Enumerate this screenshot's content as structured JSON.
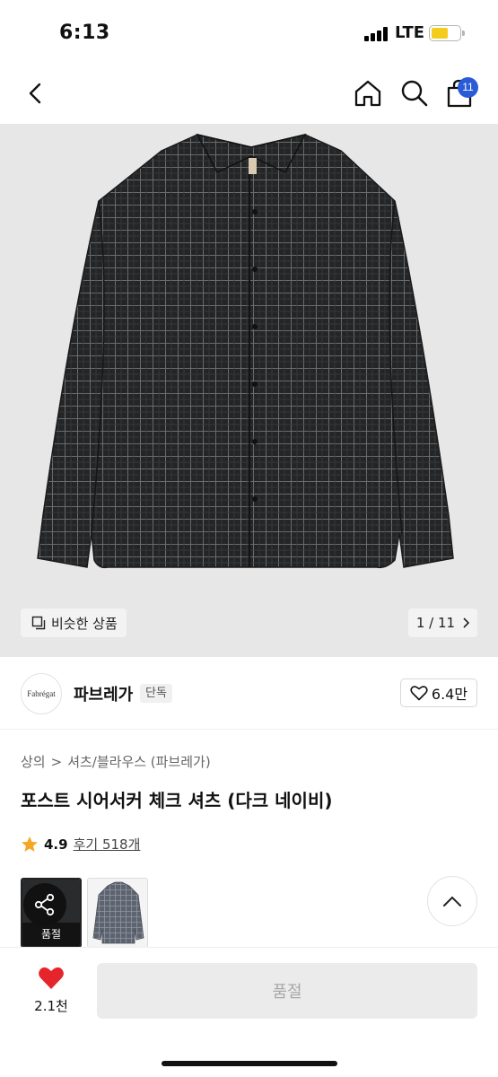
{
  "status_bar": {
    "time": "6:13",
    "network": "LTE"
  },
  "nav": {
    "cart_count": "11"
  },
  "gallery": {
    "similar_label": "비슷한 상품",
    "counter": "1 / 11"
  },
  "brand": {
    "logo_text": "Fabrégat",
    "name": "파브레가",
    "badge": "단독",
    "likes": "6.4만"
  },
  "product": {
    "breadcrumb": [
      "상의",
      "셔츠/블라우스 (파브레가)"
    ],
    "title": "포스트 시어서커 체크 셔츠 (다크 네이비)",
    "rating": "4.9",
    "reviews": "후기 518개"
  },
  "variants": {
    "soldout_label": "품절"
  },
  "bottom": {
    "wish_count": "2.1천",
    "buy_label": "품절"
  },
  "colors": {
    "accent_blue": "#2a5bd7",
    "heart_red": "#e5242b",
    "star_orange": "#f5a623"
  }
}
